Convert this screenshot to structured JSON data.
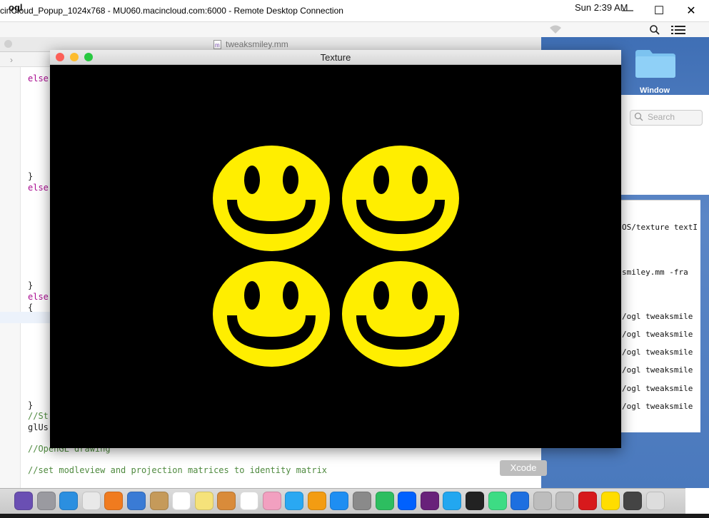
{
  "rdp": {
    "title": "cinCloud_Popup_1024x768 - MU060.macincloud.com:6000 - Remote Desktop Connection",
    "minimize": "—",
    "maximize": "☐",
    "close": "✕"
  },
  "menubar": {
    "app": "ogl",
    "clock": "Sun 2:39 AM"
  },
  "desktop": {
    "folder_label": "Window"
  },
  "finder": {
    "search_placeholder": "Search"
  },
  "terminal": {
    "lines": [
      "OS/texture textI",
      "smiley.mm -fra",
      "/ogl tweaksmile",
      "/ogl tweaksmile",
      "/ogl tweaksmile",
      "/ogl tweaksmile",
      "/ogl tweaksmile",
      "/ogl tweaksmile"
    ]
  },
  "xcode": {
    "filename": "tweaksmiley.mm",
    "code": [
      "else",
      "}",
      "else",
      "}",
      "else",
      "{",
      "}",
      "//St",
      "glUs",
      "//OpenGL drawing",
      "//set modleview and projection matrices to identity matrix"
    ]
  },
  "texture_window": {
    "title": "Texture",
    "content": "2x2 yellow smiley faces on black"
  },
  "tooltip": {
    "text": "Xcode"
  },
  "colors": {
    "smiley_yellow": "#ffee00",
    "close_light": "#fc5f57",
    "min_light": "#fdbc2e",
    "max_light": "#28c840"
  },
  "dock": {
    "icons": [
      "siri-icon",
      "launchpad-icon",
      "safari-icon",
      "chrome-icon",
      "firefox-icon",
      "preview-icon",
      "contacts-icon",
      "calendar-icon",
      "notes-icon",
      "photos-browser-icon",
      "reminders-icon",
      "photos-icon",
      "messages-icon",
      "books-icon",
      "app-store-icon",
      "system-preferences-icon",
      "evernote-icon",
      "dropbox-icon",
      "visual-studio-icon",
      "vscode-icon",
      "terminal-icon",
      "android-studio-icon",
      "xcode-icon",
      "instruments-icon",
      "instruments2-icon",
      "acrobat-icon",
      "smiley-app-icon",
      "display-icon",
      "trash-icon"
    ]
  }
}
